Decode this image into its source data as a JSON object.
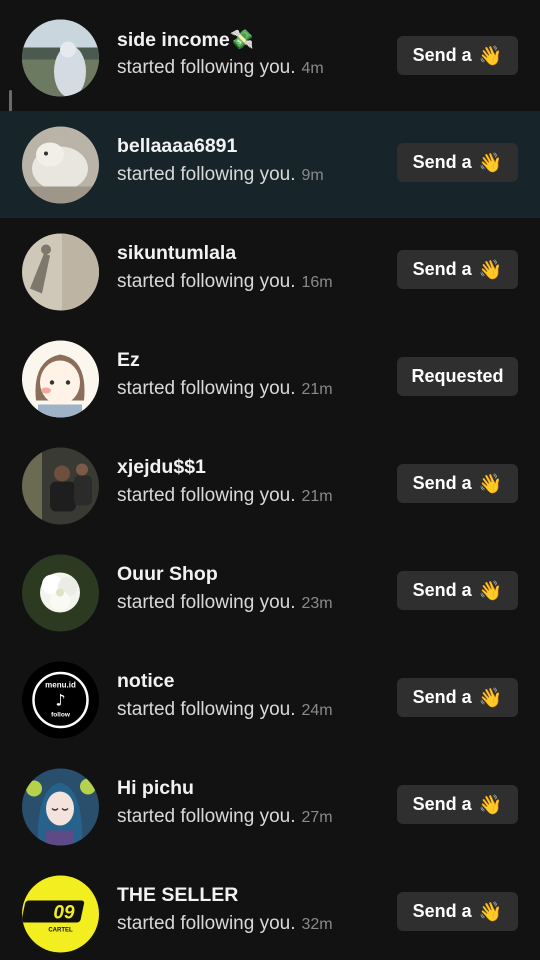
{
  "notifications": [
    {
      "name": "side income💸",
      "text": "started following you.",
      "time": "4m",
      "button": "Send a",
      "button_icon": "👋"
    },
    {
      "name": "bellaaaa6891",
      "text": "started following you.",
      "time": "9m",
      "button": "Send a",
      "button_icon": "👋"
    },
    {
      "name": "sikuntumlala",
      "text": "started following you.",
      "time": "16m",
      "button": "Send a",
      "button_icon": "👋"
    },
    {
      "name": "Ez",
      "text": "started following you.",
      "time": "21m",
      "button": "Requested",
      "button_icon": ""
    },
    {
      "name": "xjejdu$$1",
      "text": "started following you.",
      "time": "21m",
      "button": "Send a",
      "button_icon": "👋"
    },
    {
      "name": "Ouur Shop",
      "text": "started following you.",
      "time": "23m",
      "button": "Send a",
      "button_icon": "👋"
    },
    {
      "name": "notice",
      "text": "started following you.",
      "time": "24m",
      "button": "Send a",
      "button_icon": "👋"
    },
    {
      "name": "Hi pichu",
      "text": "started following you.",
      "time": "27m",
      "button": "Send a",
      "button_icon": "👋"
    },
    {
      "name": "THE SELLER",
      "text": "started following you.",
      "time": "32m",
      "button": "Send a",
      "button_icon": "👋"
    }
  ],
  "avatar_texts": {
    "notice_top": "menu.id",
    "notice_bottom": "follow",
    "seller_main": "09",
    "seller_sub": "CARTEL"
  },
  "colors": {
    "background": "#121212",
    "highlight_row": "#17252a",
    "button": "#2f2f2f",
    "scroll_indicator": "#2fc7d4"
  }
}
